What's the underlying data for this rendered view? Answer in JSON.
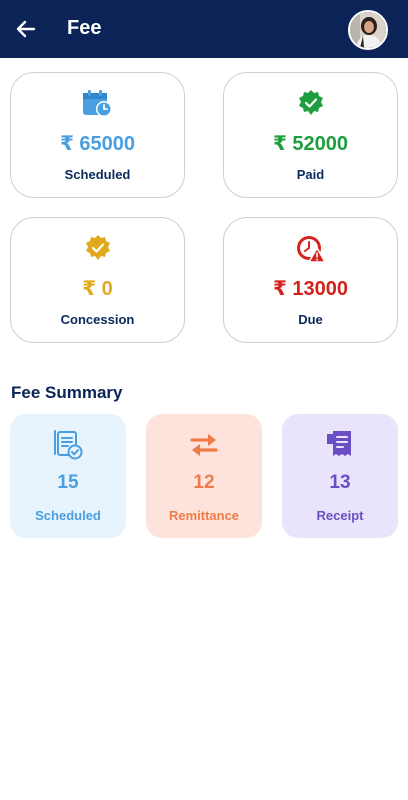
{
  "header": {
    "title": "Fee",
    "bg_color": "#0b2356",
    "back_icon": "arrow-left-icon",
    "avatar_icon": "user-avatar"
  },
  "stats": [
    {
      "id": "scheduled",
      "amount": "₹ 65000",
      "label": "Scheduled",
      "color": "#4a9fe0",
      "icon": "calendar-clock-icon"
    },
    {
      "id": "paid",
      "amount": "₹ 52000",
      "label": "Paid",
      "color": "#1e9e3e",
      "icon": "verified-check-icon"
    },
    {
      "id": "concession",
      "amount": "₹ 0",
      "label": "Concession",
      "color": "#e0a91e",
      "icon": "badge-check-icon"
    },
    {
      "id": "due",
      "amount": "₹ 13000",
      "label": "Due",
      "color": "#d4221c",
      "icon": "clock-alert-icon"
    }
  ],
  "fee_summary": {
    "title": "Fee Summary",
    "cards": [
      {
        "id": "scheduled",
        "count": "15",
        "label": "Scheduled",
        "color": "#4a9fe0",
        "bg": "#e8f4fd",
        "icon": "document-check-icon"
      },
      {
        "id": "remittance",
        "count": "12",
        "label": "Remittance",
        "color": "#ee7c4a",
        "bg": "#fde3dc",
        "icon": "swap-arrows-icon"
      },
      {
        "id": "receipt",
        "count": "13",
        "label": "Receipt",
        "color": "#6a4fc4",
        "bg": "#e9e4fb",
        "icon": "receipt-icon"
      }
    ]
  }
}
